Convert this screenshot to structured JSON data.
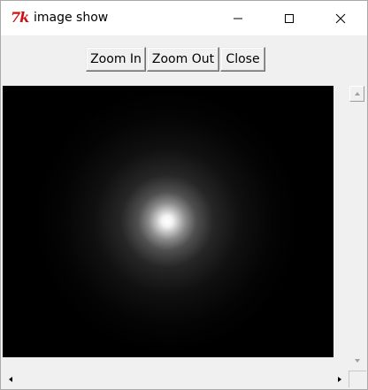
{
  "window": {
    "title": "image show",
    "app_icon": "tk-feather-logo",
    "app_icon_text": "7k",
    "controls": [
      "minimize-icon",
      "maximize-icon",
      "close-icon"
    ]
  },
  "toolbar": {
    "zoom_in_label": "Zoom In",
    "zoom_out_label": "Zoom Out",
    "close_label": "Close"
  },
  "canvas": {
    "content": "radial-glow-image",
    "background_color": "#000000",
    "glow_color": "#ffffff"
  },
  "scrollbars": {
    "vertical": [
      "scroll-up-arrow-icon",
      "scroll-down-arrow-icon"
    ],
    "horizontal": [
      "scroll-left-arrow-icon",
      "scroll-right-arrow-icon"
    ]
  },
  "colors": {
    "titlebar_bg": "#ffffff",
    "window_bg": "#f0f0f0",
    "tk_logo": "#d01010"
  }
}
